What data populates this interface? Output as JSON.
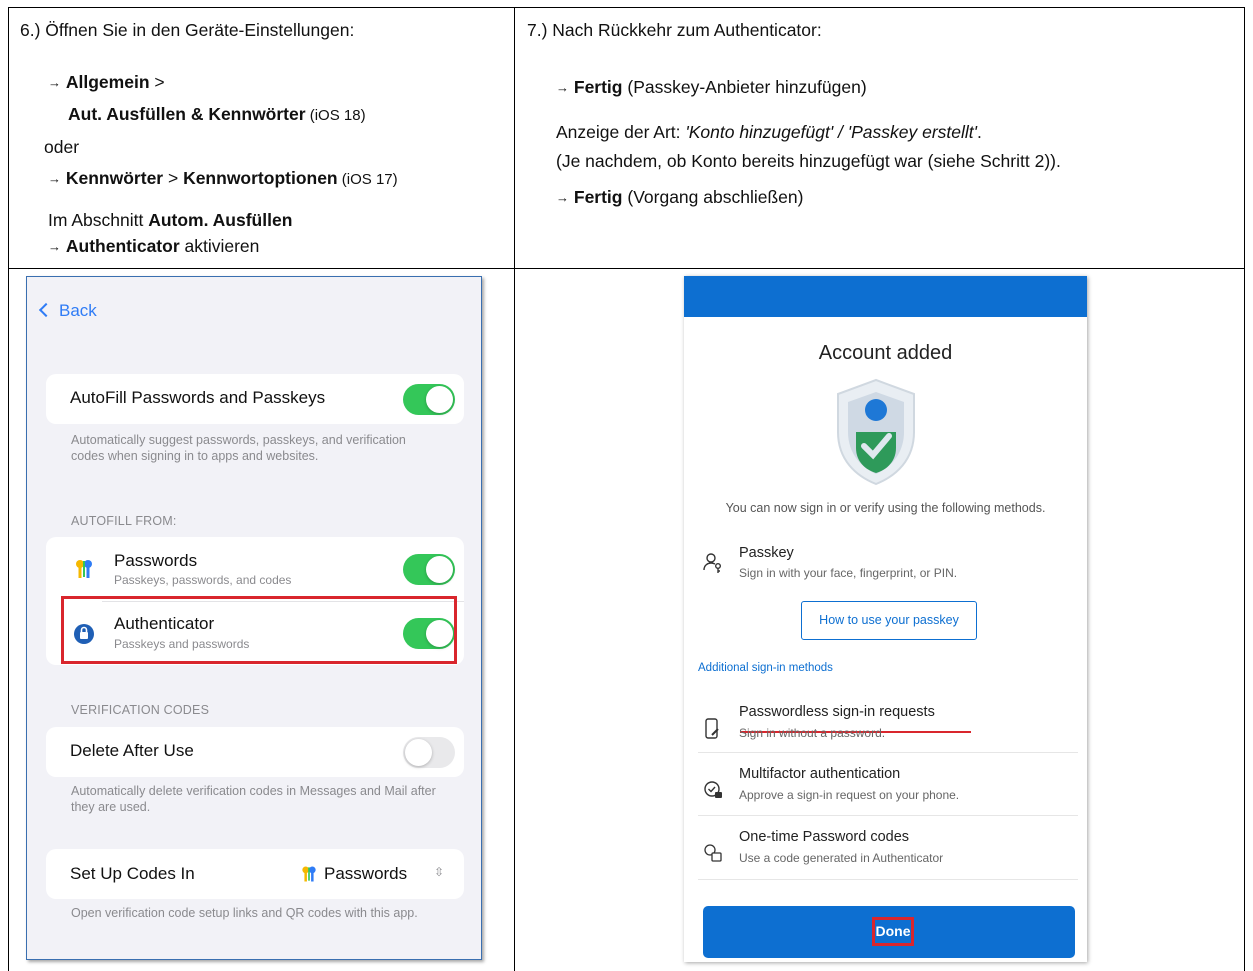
{
  "left_step": {
    "heading": "6.) Öffnen Sie in den Geräte-Einstellungen:",
    "line1_bold": "Allgemein",
    "line1_rest": " >",
    "line2_bold": "Aut. Ausfüllen & Kennwörter",
    "line2_rest": " (iOS 18)",
    "oder": "oder",
    "line3_bold_a": "Kennwörter",
    "line3_mid": " > ",
    "line3_bold_b": "Kennwortoptionen",
    "line3_rest": " (iOS 17)",
    "line4_pre": "Im Abschnitt ",
    "line4_bold": "Autom. Ausfüllen",
    "line5_bold": "Authenticator",
    "line5_rest": " aktivieren"
  },
  "right_step": {
    "heading": "7.) Nach Rückkehr zum Authenticator:",
    "line1_bold": "Fertig",
    "line1_rest": " (Passkey-Anbieter hinzufügen)",
    "line2_pre": "Anzeige der Art: ",
    "line2_italic": "'Konto hinzugefügt' / 'Passkey erstellt'",
    "line2_post": ".",
    "line3": "(Je nachdem, ob Konto bereits hinzugefügt war (siehe Schritt 2)).",
    "line4_bold": "Fertig",
    "line4_rest": " (Vorgang abschließen)",
    "arrow": "→"
  },
  "ios": {
    "back_label": "Back",
    "autofill_label": "AutoFill Passwords and Passkeys",
    "autofill_footer": "Automatically suggest passwords, passkeys, and verification codes when signing in to apps and websites.",
    "autofill_from_header": "AUTOFILL FROM:",
    "providers": [
      {
        "title": "Passwords",
        "subtitle": "Passkeys, passwords, and codes"
      },
      {
        "title": "Authenticator",
        "subtitle": "Passkeys and passwords"
      }
    ],
    "verification_header": "VERIFICATION CODES",
    "delete_label": "Delete After Use",
    "delete_footer": "Automatically delete verification codes in Messages and Mail after they are used.",
    "setup_label": "Set Up Codes In",
    "setup_value": "Passwords",
    "setup_footer": "Open verification code setup links and QR codes with this app.",
    "toggles": {
      "autofill": true,
      "passwords": true,
      "authenticator": true,
      "delete_after_use": false
    }
  },
  "auth": {
    "title": "Account added",
    "description": "You can now sign in or verify using the following methods.",
    "passkey_title": "Passkey",
    "passkey_sub": "Sign in with your face, fingerprint, or PIN.",
    "how_button": "How to use your passkey",
    "additional_header": "Additional sign-in methods",
    "methods": [
      {
        "title": "Passwordless sign-in requests",
        "subtitle": "Sign in without a password."
      },
      {
        "title": "Multifactor authentication",
        "subtitle": "Approve a sign-in request on your phone."
      },
      {
        "title": "One-time Password codes",
        "subtitle": "Use a code generated in Authenticator"
      }
    ],
    "done_label": "Done"
  },
  "colors": {
    "accent_blue": "#0d6fd1",
    "ios_green": "#34c759",
    "highlight_red": "#d9262d",
    "ios_blue": "#2f7cf6"
  }
}
